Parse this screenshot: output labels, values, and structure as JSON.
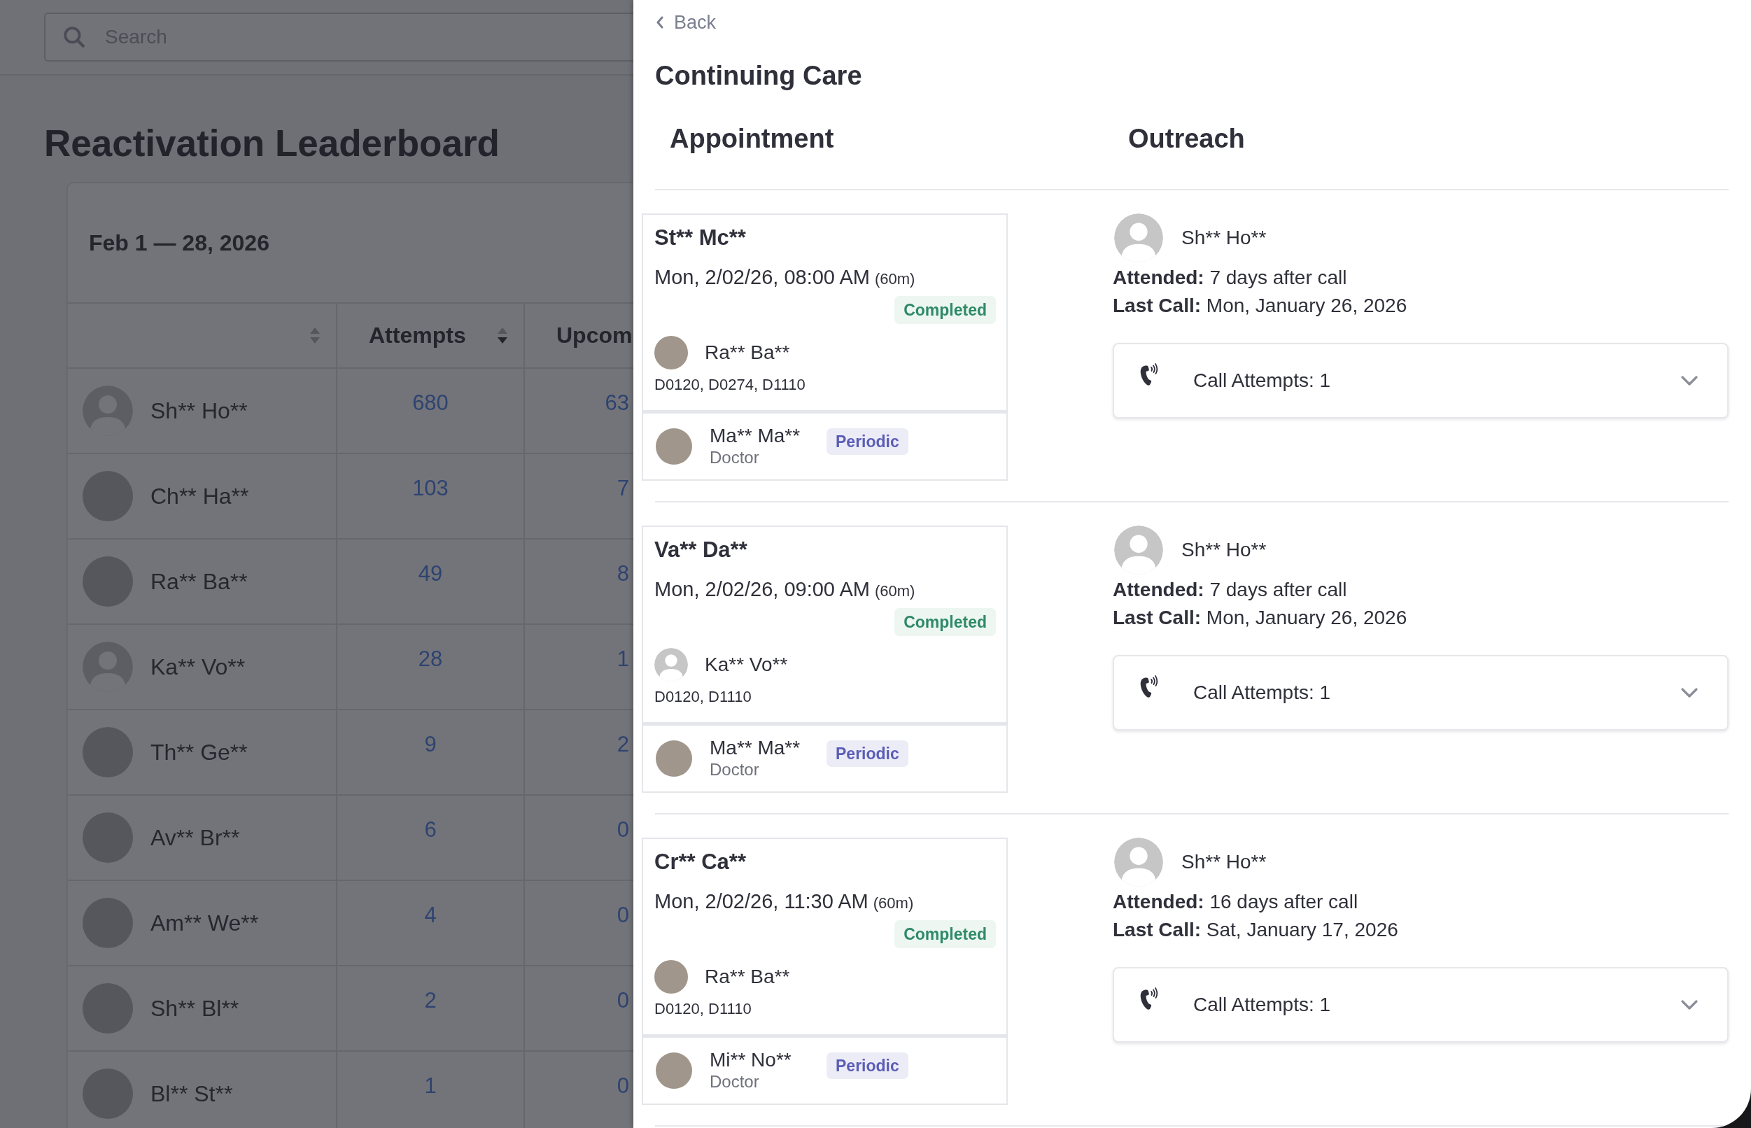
{
  "search": {
    "placeholder": "Search"
  },
  "page": {
    "title": "Reactivation Leaderboard"
  },
  "leaderboard": {
    "date_range": "Feb 1 — 28, 2026",
    "columns": [
      {
        "sorted": false
      },
      {
        "label": "Attempts",
        "sorted": true
      },
      {
        "label": "Upcom"
      }
    ],
    "rows": [
      {
        "name": "Sh** Ho**",
        "photo": false,
        "attempts": "680",
        "column_3": "63"
      },
      {
        "name": "Ch** Ha**",
        "photo": true,
        "attempts": "103",
        "column_3": "7"
      },
      {
        "name": "Ra** Ba**",
        "photo": true,
        "attempts": "49",
        "column_3": "8"
      },
      {
        "name": "Ka** Vo**",
        "photo": false,
        "attempts": "28",
        "column_3": "1"
      },
      {
        "name": "Th** Ge**",
        "photo": true,
        "attempts": "9",
        "column_3": "2"
      },
      {
        "name": "Av** Br**",
        "photo": true,
        "attempts": "6",
        "column_3": "0"
      },
      {
        "name": "Am** We**",
        "photo": true,
        "attempts": "4",
        "column_3": "0"
      },
      {
        "name": "Sh** Bl**",
        "photo": true,
        "attempts": "2",
        "column_3": "0"
      },
      {
        "name": "Bl** St**",
        "photo": true,
        "attempts": "1",
        "column_3": "0"
      }
    ]
  },
  "panel": {
    "back": "Back",
    "title": "Continuing Care",
    "columns": [
      "Appointment",
      "Outreach"
    ],
    "entries": [
      {
        "appointment": {
          "patient": "St** Mc**",
          "date": "Mon, 2/02/26, 08:00 AM",
          "duration": "(60m)",
          "status": "Completed",
          "provider": {
            "name": "Ra** Ba**",
            "photo": true
          },
          "codes": "D0120, D0274, D1110",
          "doctor": {
            "name": "Ma** Ma**",
            "role": "Doctor",
            "photo": true,
            "type": "Periodic"
          }
        },
        "outreach": {
          "caller": {
            "name": "Sh** Ho**",
            "photo": false
          },
          "attended": "**Attended:** 7 days after call",
          "last_call": "**Last Call:** Mon, January 26, 2026",
          "attempts": "Call Attempts: 1",
          "expanded": false
        }
      },
      {
        "appointment": {
          "patient": "Va** Da**",
          "date": "Mon, 2/02/26, 09:00 AM",
          "duration": "(60m)",
          "status": "Completed",
          "provider": {
            "name": "Ka** Vo**",
            "photo": false
          },
          "codes": "D0120, D1110",
          "doctor": {
            "name": "Ma** Ma**",
            "role": "Doctor",
            "photo": true,
            "type": "Periodic"
          }
        },
        "outreach": {
          "caller": {
            "name": "Sh** Ho**",
            "photo": false
          },
          "attended": "**Attended:** 7 days after call",
          "last_call": "**Last Call:** Mon, January 26, 2026",
          "attempts": "Call Attempts: 1",
          "expanded": false
        }
      },
      {
        "appointment": {
          "patient": "Cr** Ca**",
          "date": "Mon, 2/02/26, 11:30 AM",
          "duration": "(60m)",
          "status": "Completed",
          "provider": {
            "name": "Ra** Ba**",
            "photo": true
          },
          "codes": "D0120, D1110",
          "doctor": {
            "name": "Mi** No**",
            "role": "Doctor",
            "photo": true,
            "type": "Periodic"
          }
        },
        "outreach": {
          "caller": {
            "name": "Sh** Ho**",
            "photo": false
          },
          "attended": "**Attended:** 16 days after call",
          "last_call": "**Last Call:** Sat, January 17, 2026",
          "attempts": "Call Attempts: 1",
          "expanded": false
        }
      }
    ]
  }
}
